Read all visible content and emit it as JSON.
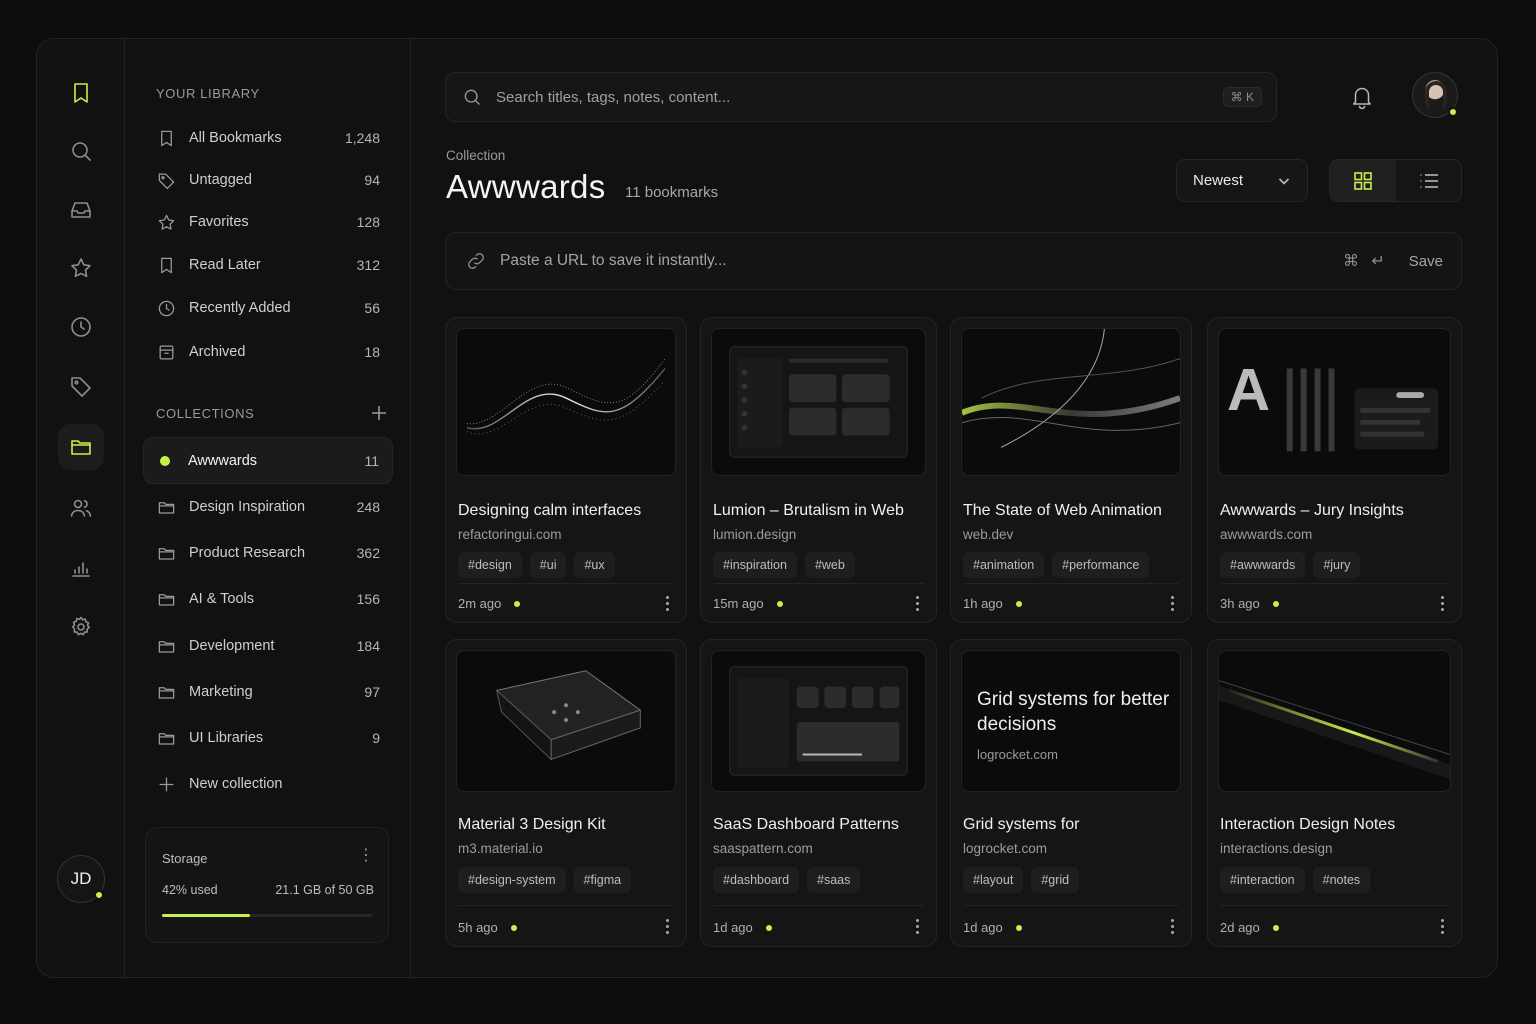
{
  "rail": {
    "items": [
      {
        "name": "bookmark-icon"
      },
      {
        "name": "search-icon"
      },
      {
        "name": "inbox-icon"
      },
      {
        "name": "star-icon"
      },
      {
        "name": "clock-icon"
      },
      {
        "name": "tag-icon"
      },
      {
        "name": "folder-icon",
        "active": true
      },
      {
        "name": "users-icon"
      },
      {
        "name": "bar-chart-icon"
      },
      {
        "name": "gear-icon"
      }
    ],
    "avatar_initials": "JD"
  },
  "library": {
    "label": "YOUR LIBRARY",
    "items": [
      {
        "label": "All Bookmarks",
        "count": "1,248",
        "icon": "bookmark-icon"
      },
      {
        "label": "Untagged",
        "count": "94",
        "icon": "tag-icon"
      },
      {
        "label": "Favorites",
        "count": "128",
        "icon": "star-icon"
      },
      {
        "label": "Read Later",
        "count": "312",
        "icon": "bookmark-icon"
      },
      {
        "label": "Recently Added",
        "count": "56",
        "icon": "clock-icon"
      },
      {
        "label": "Archived",
        "count": "18",
        "icon": "archive-icon"
      }
    ]
  },
  "collections": {
    "label": "COLLECTIONS",
    "items": [
      {
        "label": "Awwwards",
        "count": "11",
        "active": true
      },
      {
        "label": "Design Inspiration",
        "count": "248"
      },
      {
        "label": "Product Research",
        "count": "362"
      },
      {
        "label": "AI & Tools",
        "count": "156"
      },
      {
        "label": "Development",
        "count": "184"
      },
      {
        "label": "Marketing",
        "count": "97"
      },
      {
        "label": "UI Libraries",
        "count": "9"
      }
    ],
    "new_label": "New collection"
  },
  "storage": {
    "title": "Storage",
    "used_label": "42% used",
    "total_label": "21.1 GB of 50 GB",
    "used_fraction": 0.42
  },
  "search": {
    "placeholder": "Search titles, tags, notes, content...",
    "shortcut": "⌘ K"
  },
  "header": {
    "crumb": "Collection",
    "title": "Awwwards",
    "count": "11 bookmarks",
    "sort_label": "Newest"
  },
  "url_bar": {
    "placeholder": "Paste a URL to save it instantly...",
    "shortcut": "⌘ ↵",
    "save_label": "Save"
  },
  "cards": [
    {
      "title": "Designing calm interfaces",
      "domain": "refactoringui.com",
      "tags": [
        "#design",
        "#ui",
        "#ux"
      ],
      "time": "2m ago",
      "thumb": "wave"
    },
    {
      "title": "Lumion – Brutalism in Web",
      "domain": "lumion.design",
      "tags": [
        "#inspiration",
        "#web"
      ],
      "time": "15m ago",
      "thumb": "dashboard"
    },
    {
      "title": "The State of Web Animation",
      "domain": "web.dev",
      "tags": [
        "#animation",
        "#performance"
      ],
      "time": "1h ago",
      "thumb": "swoosh"
    },
    {
      "title": "Awwwards – Jury Insights",
      "domain": "awwwards.com",
      "tags": [
        "#awwwards",
        "#jury"
      ],
      "time": "3h ago",
      "thumb": "jury"
    },
    {
      "title": "Material 3 Design Kit",
      "domain": "m3.material.io",
      "tags": [
        "#design-system",
        "#figma"
      ],
      "time": "5h ago",
      "thumb": "device"
    },
    {
      "title": "SaaS Dashboard Patterns",
      "domain": "saaspattern.com",
      "tags": [
        "#dashboard",
        "#saas"
      ],
      "time": "1d ago",
      "thumb": "dashboard2"
    },
    {
      "title": "Grid systems for",
      "domain": "logrocket.com",
      "tags": [
        "#layout",
        "#grid"
      ],
      "time": "1d ago",
      "thumb": "text",
      "thumb_heading": "Grid systems for better decisions",
      "thumb_domain": "logrocket.com"
    },
    {
      "title": "Interaction Design Notes",
      "domain": "interactions.design",
      "tags": [
        "#interaction",
        "#notes"
      ],
      "time": "2d ago",
      "thumb": "beam"
    }
  ],
  "colors": {
    "accent": "#c8f04a",
    "background": "#0d0d0d",
    "panel": "#111111"
  }
}
